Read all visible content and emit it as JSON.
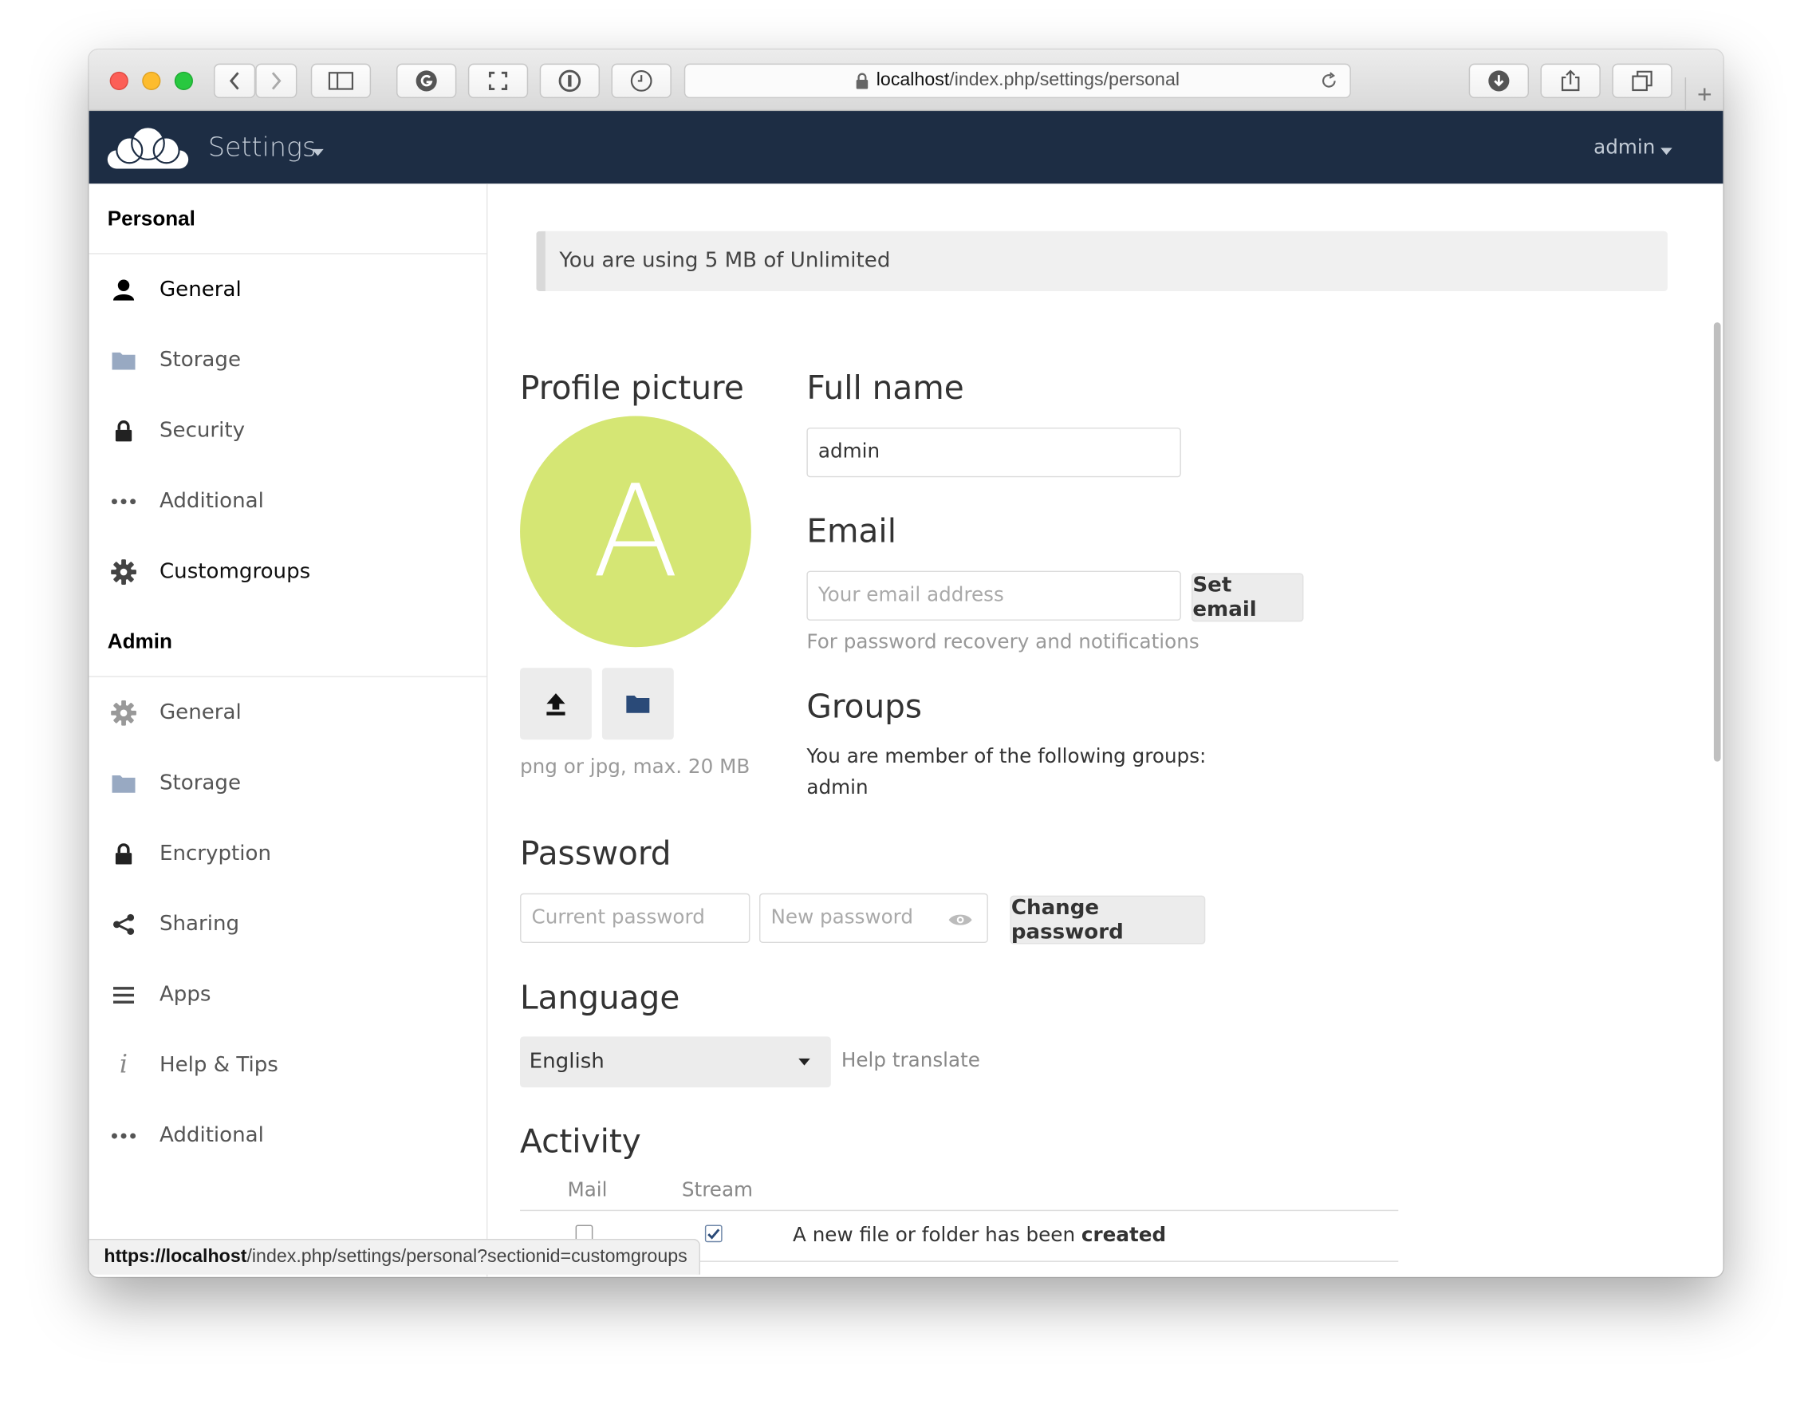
{
  "browser": {
    "url_host": "localhost",
    "url_path": "/index.php/settings/personal",
    "status_url_host": "https://localhost",
    "status_url_path": "/index.php/settings/personal?sectionid=customgroups"
  },
  "header": {
    "app_title": "Settings",
    "user": "admin"
  },
  "sidebar": {
    "personal_heading": "Personal",
    "personal_items": [
      {
        "label": "General",
        "icon": "user-icon"
      },
      {
        "label": "Storage",
        "icon": "folder-icon"
      },
      {
        "label": "Security",
        "icon": "lock-icon"
      },
      {
        "label": "Additional",
        "icon": "more-icon"
      },
      {
        "label": "Customgroups",
        "icon": "gear-icon"
      }
    ],
    "admin_heading": "Admin",
    "admin_items": [
      {
        "label": "General",
        "icon": "gear-icon"
      },
      {
        "label": "Storage",
        "icon": "folder-icon"
      },
      {
        "label": "Encryption",
        "icon": "lock-icon"
      },
      {
        "label": "Sharing",
        "icon": "share-icon"
      },
      {
        "label": "Apps",
        "icon": "menu-icon"
      },
      {
        "label": "Help & Tips",
        "icon": "info-icon"
      },
      {
        "label": "Additional",
        "icon": "more-icon"
      }
    ]
  },
  "quota": {
    "text": "You are using 5 MB of Unlimited"
  },
  "profile": {
    "heading": "Profile picture",
    "avatar_letter": "A",
    "avatar_color": "#d5e674",
    "hint": "png or jpg, max. 20 MB"
  },
  "fullname": {
    "heading": "Full name",
    "value": "admin"
  },
  "email": {
    "heading": "Email",
    "placeholder": "Your email address",
    "button": "Set email",
    "hint": "For password recovery and notifications"
  },
  "groups": {
    "heading": "Groups",
    "text": "You are member of the following groups:",
    "list": "admin"
  },
  "password": {
    "heading": "Password",
    "current_placeholder": "Current password",
    "new_placeholder": "New password",
    "button": "Change password"
  },
  "language": {
    "heading": "Language",
    "selected": "English",
    "help_link": "Help translate"
  },
  "activity": {
    "heading": "Activity",
    "col_mail": "Mail",
    "col_stream": "Stream",
    "row1_text": "A new file or folder has been ",
    "row1_bold": "created"
  },
  "colors": {
    "header_bg": "#1d2d44",
    "accent": "#d5e674"
  }
}
